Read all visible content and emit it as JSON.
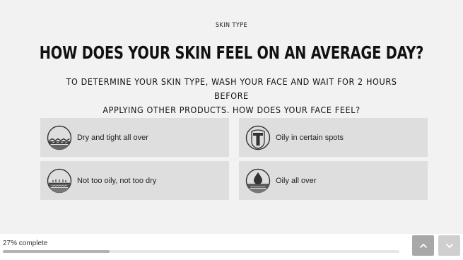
{
  "quiz": {
    "section": "SKIN TYPE",
    "question": "HOW DOES YOUR SKIN FEEL ON AN AVERAGE DAY?",
    "instructions_line1": "TO DETERMINE YOUR SKIN TYPE, WASH YOUR FACE AND WAIT FOR 2 HOURS BEFORE",
    "instructions_line2": "APPLYING OTHER PRODUCTS. HOW DOES YOUR FACE FEEL?",
    "options": [
      {
        "label": "Dry and tight all over",
        "icon": "dry-skin-icon"
      },
      {
        "label": "Oily in certain spots",
        "icon": "t-zone-icon"
      },
      {
        "label": "Not too oily, not too dry",
        "icon": "normal-skin-icon"
      },
      {
        "label": "Oily all over",
        "icon": "oil-drop-icon"
      }
    ]
  },
  "footer": {
    "progress_text": "27% complete",
    "progress_value": 0.27,
    "prev_icon": "chevron-up-icon",
    "next_icon": "chevron-down-icon"
  },
  "colors": {
    "background": "#f2f2f2",
    "option_bg": "#dedede",
    "progress_fill": "#b3b3b3",
    "prev_button": "#a8a8a8",
    "next_button": "#cfcfcf"
  }
}
